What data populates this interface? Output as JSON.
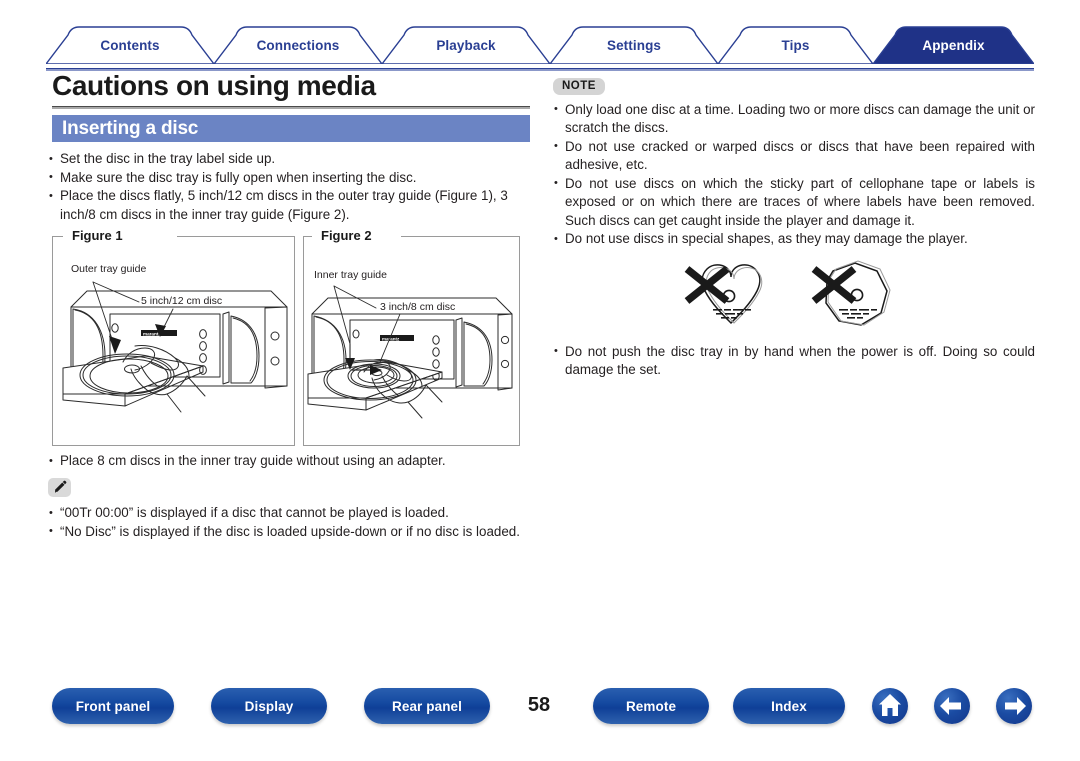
{
  "tabs": [
    {
      "label": "Contents",
      "active": false
    },
    {
      "label": "Connections",
      "active": false
    },
    {
      "label": "Playback",
      "active": false
    },
    {
      "label": "Settings",
      "active": false
    },
    {
      "label": "Tips",
      "active": false
    },
    {
      "label": "Appendix",
      "active": true
    }
  ],
  "page": {
    "title": "Cautions on using media",
    "section_title": "Inserting a disc",
    "number": "58"
  },
  "left": {
    "intro_bullets": [
      "Set the disc in the tray label side up.",
      "Make sure the disc tray is fully open when inserting the disc.",
      "Place the discs flatly, 5 inch/12 cm discs in the outer tray guide (Figure 1), 3 inch/8 cm discs in the inner tray guide (Figure 2)."
    ],
    "figure1": {
      "label": "Figure 1",
      "callout_guide": "Outer tray guide",
      "callout_disc": "5 inch/12 cm disc",
      "brand": "marantz"
    },
    "figure2": {
      "label": "Figure 2",
      "callout_guide": "Inner tray guide",
      "callout_disc": "3 inch/8 cm disc",
      "brand": "marantz"
    },
    "after_figures_bullet": "Place 8 cm discs in the inner tray guide without using an adapter.",
    "tip_badge_icon": "pencil-icon",
    "tip_bullets": [
      "“00Tr  00:00” is displayed if a disc that cannot be played is loaded.",
      "“No Disc” is displayed if the disc is loaded upside-down or if no disc is loaded."
    ]
  },
  "right": {
    "note_badge": "NOTE",
    "note_bullets_top": [
      "Only load one disc at a time. Loading two or more discs can damage the unit or scratch the discs.",
      "Do not use cracked or warped discs or discs that have been repaired with adhesive, etc.",
      "Do not use discs on which the sticky part of cellophane tape or labels is exposed or on which there are traces of where labels have been removed. Such discs can get caught inside the player and damage it.",
      "Do not use discs in special shapes, as they may damage the player."
    ],
    "shapes": [
      {
        "name": "heart-shaped-disc",
        "forbidden": true
      },
      {
        "name": "octagon-shaped-disc",
        "forbidden": true
      }
    ],
    "note_bullets_bottom": [
      "Do not push the disc tray in by hand when the power is off. Doing so could damage the set."
    ]
  },
  "bottom_nav": {
    "buttons": [
      {
        "label": "Front panel"
      },
      {
        "label": "Display"
      },
      {
        "label": "Rear panel"
      },
      {
        "label": "Remote"
      },
      {
        "label": "Index"
      }
    ],
    "icons": [
      {
        "name": "home-icon"
      },
      {
        "name": "arrow-left-icon"
      },
      {
        "name": "arrow-right-icon"
      }
    ]
  },
  "colors": {
    "tab_active_bg": "#1f3287",
    "tab_text": "#2a3f93",
    "section_bar": "#6b84c4",
    "pill_blue": "#15489e"
  }
}
